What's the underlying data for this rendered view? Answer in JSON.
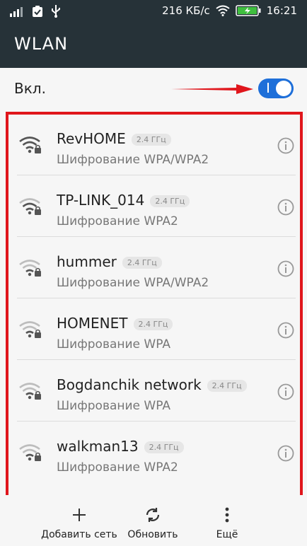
{
  "status_bar": {
    "speed": "216 КБ/с",
    "time": "16:21"
  },
  "app_bar": {
    "title": "WLAN"
  },
  "wlan_toggle": {
    "label": "Вкл.",
    "state": "on"
  },
  "networks": [
    {
      "ssid": "RevHOME",
      "band": "2.4 ГГц",
      "security": "Шифрование WPA/WPA2"
    },
    {
      "ssid": "TP-LINK_014",
      "band": "2.4 ГГц",
      "security": "Шифрование WPA2"
    },
    {
      "ssid": "hummer",
      "band": "2.4 ГГц",
      "security": "Шифрование WPA/WPA2"
    },
    {
      "ssid": "HOMENET",
      "band": "2.4 ГГц",
      "security": "Шифрование WPA"
    },
    {
      "ssid": "Bogdanchik network",
      "band": "2.4 ГГц",
      "security": "Шифрование WPA"
    },
    {
      "ssid": "walkman13",
      "band": "2.4 ГГц",
      "security": "Шифрование WPA2"
    }
  ],
  "bottom_actions": {
    "add": "Добавить сеть",
    "refresh": "Обновить",
    "more": "Ещё"
  },
  "colors": {
    "bar": "#263238",
    "accent": "#1e6fd9",
    "highlight": "#e0161c"
  }
}
